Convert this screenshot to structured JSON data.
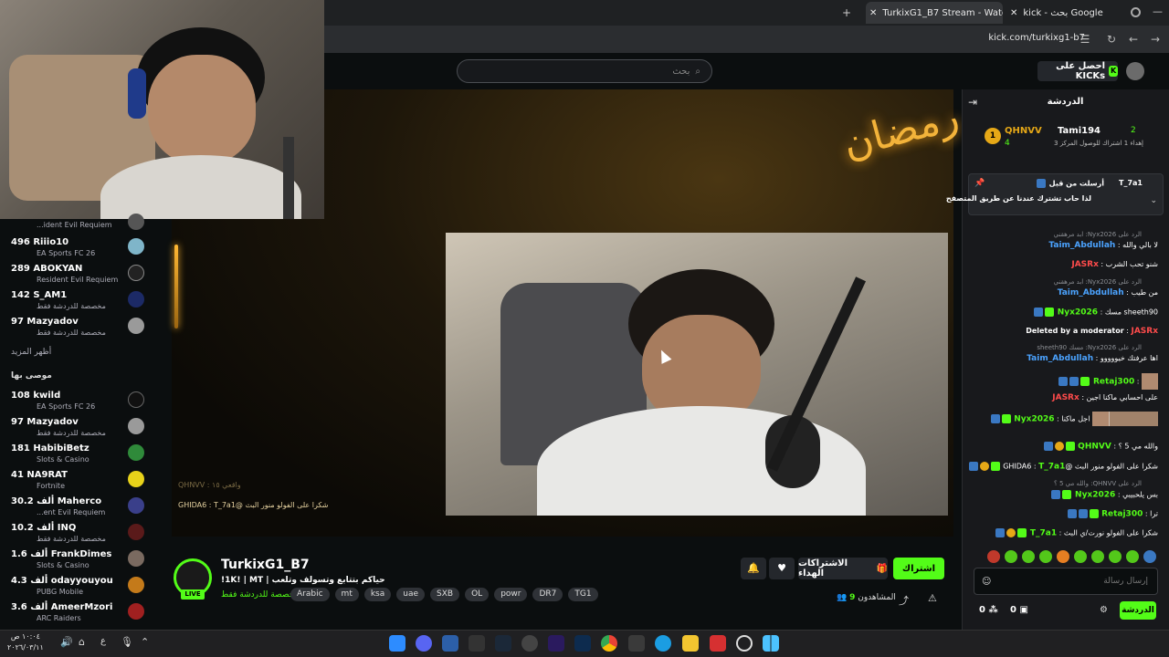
{
  "browser": {
    "tabs": [
      {
        "label": "TurkixG1_B7 Stream - Watch",
        "active": true
      },
      {
        "label": "kick - بحث Google",
        "active": false
      }
    ],
    "url": "kick.com/turkixg1-b7"
  },
  "header": {
    "search_placeholder": "بحث",
    "get_kicks_label": "احصل على KICKs"
  },
  "sidebar": {
    "top_items": [
      {
        "count": "",
        "name": "",
        "category": "...ident Evil Requiem"
      },
      {
        "count": "496",
        "name": "Riiio10",
        "category": "EA Sports FC 26"
      },
      {
        "count": "289",
        "name": "ABOKYAN",
        "category": "Resident Evil Requiem"
      },
      {
        "count": "142",
        "name": "S_AM1",
        "category": "مخصصة للدردشة فقط"
      },
      {
        "count": "97",
        "name": "Mazyadov",
        "category": "مخصصة للدردشة فقط"
      }
    ],
    "show_more": "أظهر المزيد",
    "recommended_title": "موصى بها",
    "recommended": [
      {
        "count": "108",
        "name": "kwild",
        "category": "EA Sports FC 26"
      },
      {
        "count": "97",
        "name": "Mazyadov",
        "category": "مخصصة للدردشة فقط"
      },
      {
        "count": "181",
        "name": "HabibiBetz",
        "category": "Slots & Casino"
      },
      {
        "count": "41",
        "name": "NA9RAT",
        "category": "Fortnite"
      },
      {
        "count": "30.2 ألف",
        "name": "Maherco",
        "category": "...ent Evil Requiem"
      },
      {
        "count": "10.2 ألف",
        "name": "INQ",
        "category": "مخصصة للدردشة فقط"
      },
      {
        "count": "1.6 ألف",
        "name": "FrankDimes",
        "category": "Slots & Casino"
      },
      {
        "count": "4.3 ألف",
        "name": "odayyouyou",
        "category": "PUBG Mobile"
      },
      {
        "count": "3.6 ألف",
        "name": "AmeerMzori",
        "category": "ARC Raiders"
      }
    ]
  },
  "stream": {
    "overlay_line": "شكرا على الفولو منور البث @GHIDA6 : T_7a1",
    "overlay_line_faded": "واقعي ١٥ : QHNVV",
    "channel_name": "TurkixG1_B7",
    "title": "حياكم بتتابع وتسولف وتلعب | 1K! | MT!",
    "category": "مخصصة للدردشة فقط",
    "live_label": "LIVE",
    "tags": [
      "Arabic",
      "mt",
      "ksa",
      "uae",
      "SXB",
      "OL",
      "powr",
      "DR7",
      "TG1"
    ],
    "subscribe_label": "اشتراك",
    "gift_label": "الاشتراكات الهداء",
    "viewers_label": "المشاهدون",
    "viewers_count": "9",
    "ramadan_art": "رمضان"
  },
  "chat": {
    "title": "الدردشة",
    "leaderboard": [
      {
        "rank": "1",
        "name": "QHNVV",
        "value": "4"
      },
      {
        "rank": "2",
        "name": "Tami194",
        "value": "2"
      }
    ],
    "leader_note": "إهداء 1 اشتراك للوصول المركز 3",
    "pinned_user": "T_7a1",
    "pinned_meta": "أرسلت من قبل",
    "pinned_text": "لذا حاب تشترك عندنا عن طريق المتصفح",
    "messages": [
      {
        "type": "reply",
        "text": "الرد على Nyx2026: ابد مرهقني"
      },
      {
        "type": "msg",
        "user": "Taim_Abdullah",
        "color": "#4ba3ff",
        "text": "لا بالي والله"
      },
      {
        "type": "msg",
        "user": "JASRx",
        "color": "#ff4b4b",
        "text": "شنو تحب الشرب"
      },
      {
        "type": "reply",
        "text": "الرد على Nyx2026: ابد مرهقني"
      },
      {
        "type": "msg",
        "user": "Taim_Abdullah",
        "color": "#4ba3ff",
        "text": "من طيب"
      },
      {
        "type": "msg",
        "user": "Nyx2026",
        "color": "#53fc18",
        "text": "sheeth90 مسك"
      },
      {
        "type": "msg",
        "user": "JASRx",
        "color": "#ff4b4b",
        "text": "Deleted by a moderator"
      },
      {
        "type": "reply",
        "text": "الرد على Nyx2026: مسك sheeth90"
      },
      {
        "type": "msg",
        "user": "Taim_Abdullah",
        "color": "#4ba3ff",
        "text": "اها عرفتك خيووووو"
      },
      {
        "type": "msg",
        "user": "Retaj300",
        "color": "#53fc18",
        "text": ""
      },
      {
        "type": "msg",
        "user": "JASRx",
        "color": "#ff4b4b",
        "text": "على احسابي ماكنا اجين"
      },
      {
        "type": "msg",
        "user": "Nyx2026",
        "color": "#53fc18",
        "text": "اجل ماكنا"
      },
      {
        "type": "msg",
        "user": "QHNVV",
        "color": "#53fc18",
        "text": "والله مي 5 ؟"
      },
      {
        "type": "msg",
        "user": "T_7a1",
        "color": "#53fc18",
        "text": "شكرا على الفولو منور البث @GHIDA6"
      },
      {
        "type": "reply",
        "text": "الرد على QHNVV: والله مي 5 ؟"
      },
      {
        "type": "msg",
        "user": "Nyx2026",
        "color": "#53fc18",
        "text": "بس يلحبيبي"
      },
      {
        "type": "msg",
        "user": "Retaj300",
        "color": "#53fc18",
        "text": "ترا"
      },
      {
        "type": "msg",
        "user": "T_7a1",
        "color": "#53fc18",
        "text": "شكرا على الفولو نورت/ي البث"
      }
    ],
    "input_placeholder": "إرسال رسالة",
    "send_label": "الدردشة",
    "points": "0",
    "gifts": "0"
  },
  "taskbar": {
    "time": "١٠:٠٤ ص",
    "date": "٢٠٢٦/٠٣/١١",
    "lang": "ع"
  },
  "colors": {
    "accent": "#53fc18",
    "background": "#0b0e0f",
    "chat_bg": "#18191c"
  }
}
